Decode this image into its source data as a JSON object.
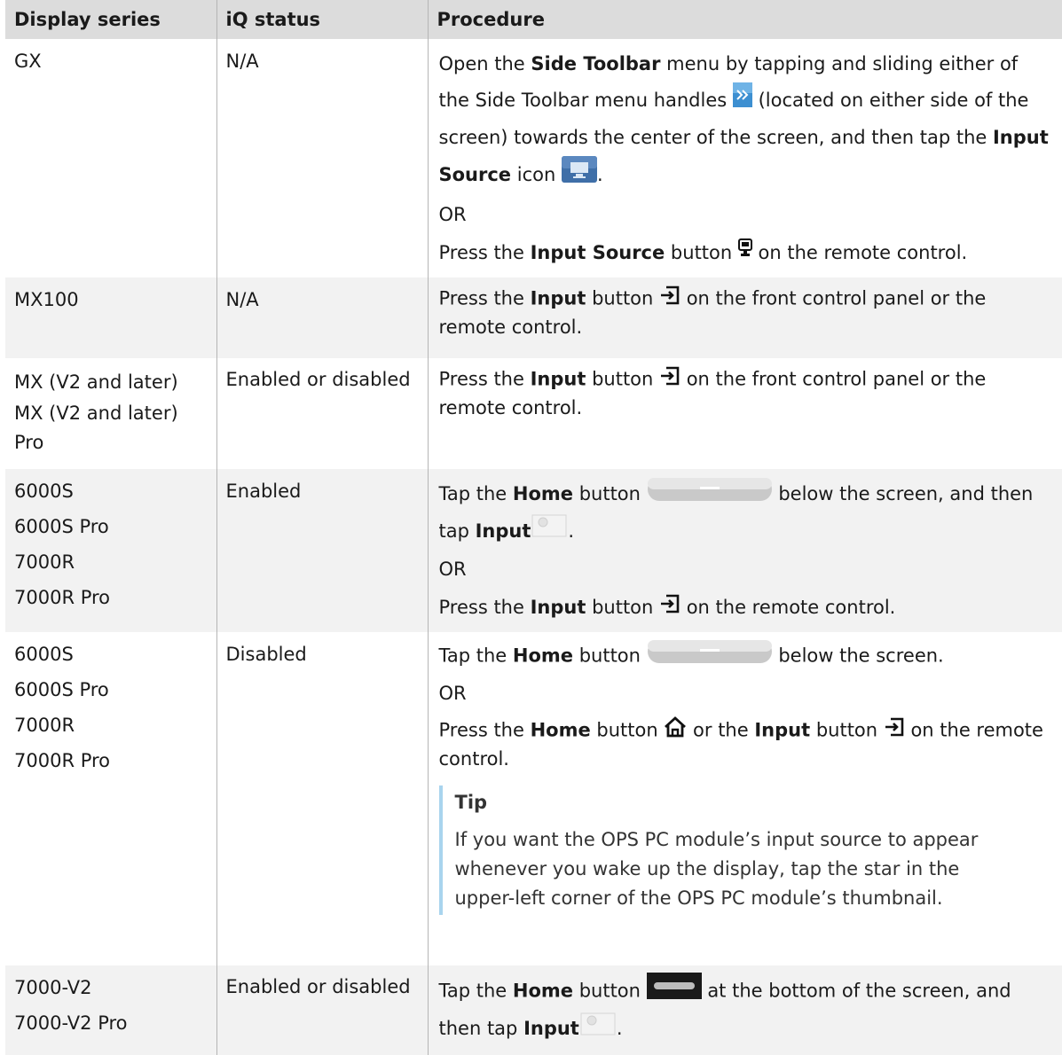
{
  "headers": [
    "Display series",
    "iQ status",
    "Procedure"
  ],
  "rows": [
    {
      "series": [
        "GX"
      ],
      "status": "N/A",
      "p1": {
        "t1": "Open the ",
        "b1": "Side Toolbar",
        "t2": " menu by tapping and sliding either of the Side Toolbar menu handles ",
        "t3": " (located on either side of the screen) towards the center of the screen, and then tap the ",
        "b2": "Input Source",
        "t4": " icon ",
        "t5": "."
      },
      "or": "OR",
      "p2": {
        "t1": "Press the ",
        "b1": "Input Source",
        "t2": " button ",
        "t3": " on the remote control."
      }
    },
    {
      "series": [
        "MX100"
      ],
      "status": "N/A",
      "p1": {
        "t1": "Press the ",
        "b1": "Input",
        "t2": " button ",
        "t3": " on the front control panel or the remote control."
      }
    },
    {
      "series": [
        "MX (V2 and later)",
        "MX (V2 and later) Pro"
      ],
      "status": "Enabled or disabled",
      "p1": {
        "t1": "Press the ",
        "b1": "Input",
        "t2": " button ",
        "t3": " on the front control panel or the remote control."
      }
    },
    {
      "series": [
        "6000S",
        "6000S Pro",
        "7000R",
        "7000R Pro"
      ],
      "status": "Enabled",
      "p1": {
        "t1": "Tap the ",
        "b1": "Home",
        "t2": " button ",
        "t3": " below the screen, and then tap ",
        "b2": "Input",
        "t4": "."
      },
      "or": "OR",
      "p2": {
        "t1": "Press the ",
        "b1": "Input",
        "t2": " button ",
        "t3": " on the remote control."
      }
    },
    {
      "series": [
        "6000S",
        "6000S Pro",
        "7000R",
        "7000R Pro"
      ],
      "status": "Disabled",
      "p1": {
        "t1": "Tap the ",
        "b1": "Home",
        "t2": " button ",
        "t3": " below the screen."
      },
      "or": "OR",
      "p2": {
        "t1": "Press the ",
        "b1": "Home",
        "t2": " button ",
        "t3": " or the ",
        "b2": "Input",
        "t4": " button ",
        "t5": " on the remote control."
      },
      "tip": {
        "title": "Tip",
        "text": "If you want the OPS PC module’s input source to appear whenever you wake up the display, tap the star in the upper-left corner of the OPS PC module’s thumbnail."
      }
    },
    {
      "series": [
        "7000-V2",
        "7000-V2 Pro"
      ],
      "status": "Enabled or disabled",
      "p1": {
        "t1": "Tap the ",
        "b1": "Home",
        "t2": " button ",
        "t3": " at the bottom of the screen, and then tap ",
        "b2": "Input",
        "t4": "."
      }
    }
  ],
  "icons": {
    "menu_handle": "double-chevron-right-icon",
    "input_source": "monitor-icon",
    "remote_input_source": "input-source-remote-icon",
    "input": "input-arrow-icon",
    "home_pill": "home-pill-button-icon",
    "input_tile": "input-tile-icon",
    "home": "home-icon",
    "home_dark": "home-bar-button-icon"
  },
  "colors": {
    "header_bg": "#dcdcdc",
    "shaded_bg": "#f2f2f2",
    "tip_border": "#a9d4ee",
    "icon_blue": "#3d8fd1"
  }
}
